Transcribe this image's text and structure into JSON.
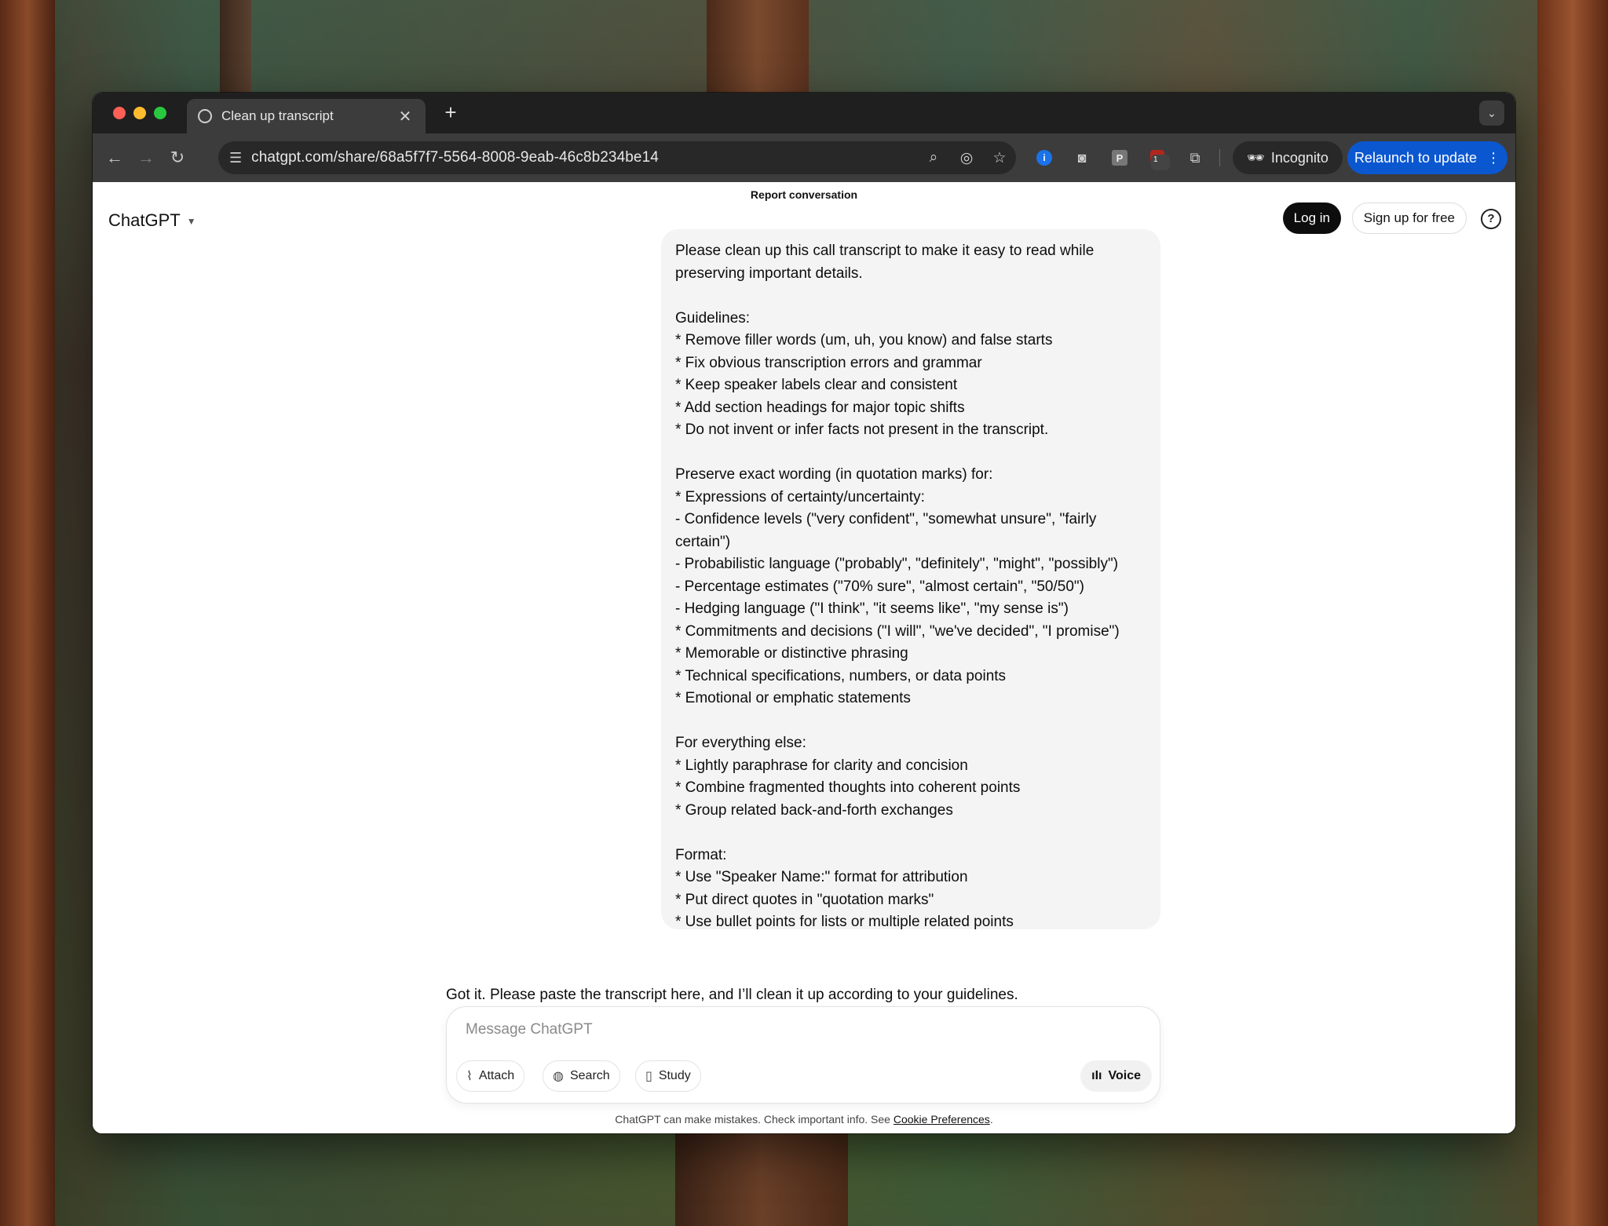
{
  "browser": {
    "tab_title": "Clean up transcript",
    "url": "chatgpt.com/share/68a5f7f7-5564-8008-9eab-46c8b234be14",
    "incognito_label": "Incognito",
    "relaunch_label": "Relaunch to update",
    "extension_badge": "1"
  },
  "header": {
    "report_label": "Report conversation",
    "brand": "ChatGPT",
    "login_label": "Log in",
    "signup_label": "Sign up for free",
    "help_glyph": "?"
  },
  "conversation": {
    "user_message": "Please clean up this call transcript to make it easy to read while preserving important details.\n\nGuidelines:\n* Remove filler words (um, uh, you know) and false starts\n* Fix obvious transcription errors and grammar\n* Keep speaker labels clear and consistent\n* Add section headings for major topic shifts\n* Do not invent or infer facts not present in the transcript.\n\nPreserve exact wording (in quotation marks) for:\n* Expressions of certainty/uncertainty:\n- Confidence levels (\"very confident\", \"somewhat unsure\", \"fairly certain\")\n- Probabilistic language (\"probably\", \"definitely\", \"might\", \"possibly\")\n- Percentage estimates (\"70% sure\", \"almost certain\", \"50/50\")\n- Hedging language (\"I think\", \"it seems like\", \"my sense is\")\n* Commitments and decisions (\"I will\", \"we've decided\", \"I promise\")\n* Memorable or distinctive phrasing\n* Technical specifications, numbers, or data points\n* Emotional or emphatic statements\n\nFor everything else:\n* Lightly paraphrase for clarity and concision\n* Combine fragmented thoughts into coherent points\n* Group related back-and-forth exchanges\n\nFormat:\n* Use \"Speaker Name:\" format for attribution\n* Put direct quotes in \"quotation marks\"\n* Use bullet points for lists or multiple related points",
    "assistant_message": "Got it. Please paste the transcript here, and I’ll clean it up according to your guidelines."
  },
  "composer": {
    "placeholder": "Message ChatGPT",
    "attach_label": "Attach",
    "search_label": "Search",
    "study_label": "Study",
    "voice_label": "Voice"
  },
  "footer": {
    "text": "ChatGPT can make mistakes. Check important info. See ",
    "link": "Cookie Preferences",
    "end": "."
  },
  "icons": [
    "back-icon",
    "forward-icon",
    "reload-icon",
    "site-settings-icon",
    "zoom-icon",
    "eye-off-icon",
    "star-icon",
    "password-manager-icon",
    "camera-icon",
    "p-extension-icon",
    "ublock-icon",
    "puzzle-icon",
    "incognito-icon",
    "kebab-icon",
    "paperclip-icon",
    "globe-icon",
    "book-icon",
    "voice-wave-icon",
    "help-icon",
    "chevron-down-icon"
  ]
}
